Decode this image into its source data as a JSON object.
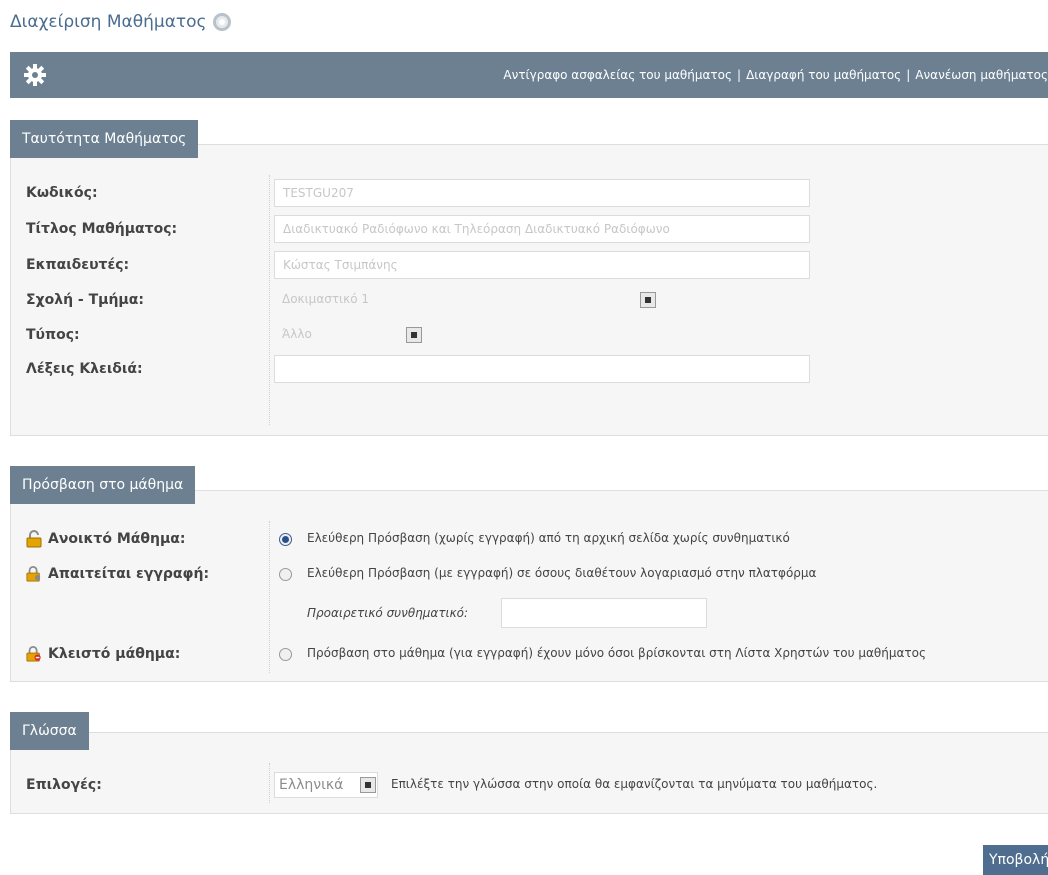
{
  "page": {
    "title": "Διαχείριση Μαθήματος"
  },
  "toolbar": {
    "links": [
      "Αντίγραφο ασφαλείας του μαθήματος",
      "Διαγραφή του μαθήματος",
      "Ανανέωση μαθήματος"
    ],
    "separator": "|"
  },
  "identity": {
    "legend": "Ταυτότητα Μαθήματος",
    "code_label": "Κωδικός:",
    "code_value": "TESTGU207",
    "title_label": "Τίτλος Μαθήματος:",
    "title_value": "Διαδικτυακό Ραδιόφωνο και Τηλεόραση Διαδικτυακό Ραδιόφωνο",
    "instructors_label": "Εκπαιδευτές:",
    "instructors_value": "Κώστας Τσιμπάνης",
    "department_label": "Σχολή - Τμήμα:",
    "department_value": "Δοκιμαστικό 1",
    "type_label": "Τύπος:",
    "type_value": "Άλλο",
    "keywords_label": "Λέξεις Κλειδιά:",
    "keywords_value": ""
  },
  "access": {
    "legend": "Πρόσβαση στο μάθημα",
    "open_label": "Ανοικτό Μάθημα:",
    "open_text": "Ελεύθερη Πρόσβαση (χωρίς εγγραφή) από τη αρχική σελίδα χωρίς συνθηματικό",
    "registration_label": "Απαιτείται εγγραφή:",
    "registration_text": "Ελεύθερη Πρόσβαση (με εγγραφή) σε όσους διαθέτουν λογαριασμό στην πλατφόρμα",
    "password_label": "Προαιρετικό συνθηματικό:",
    "password_value": "",
    "closed_label": "Κλειστό μάθημα:",
    "closed_text": "Πρόσβαση στο μάθημα (για εγγραφή) έχουν μόνο όσοι βρίσκονται στη Λίστα Χρηστών του μαθήματος",
    "selected": "open"
  },
  "language": {
    "legend": "Γλώσσα",
    "options_label": "Επιλογές:",
    "selected_value": "Ελληνικά",
    "help_text": "Επιλέξτε την γλώσσα στην οποία θα εμφανίζονται τα μηνύματα του μαθήματος."
  },
  "submit_label": "Υποβολή",
  "icons": {
    "title": "settings-icon",
    "toolbar": "gear-icon",
    "open": "lock-open-icon",
    "registration": "lock-key-icon",
    "closed": "lock-closed-icon"
  },
  "colors": {
    "bar": "#6d8092",
    "title": "#4a6c8f",
    "submit": "#4f6d8e"
  }
}
